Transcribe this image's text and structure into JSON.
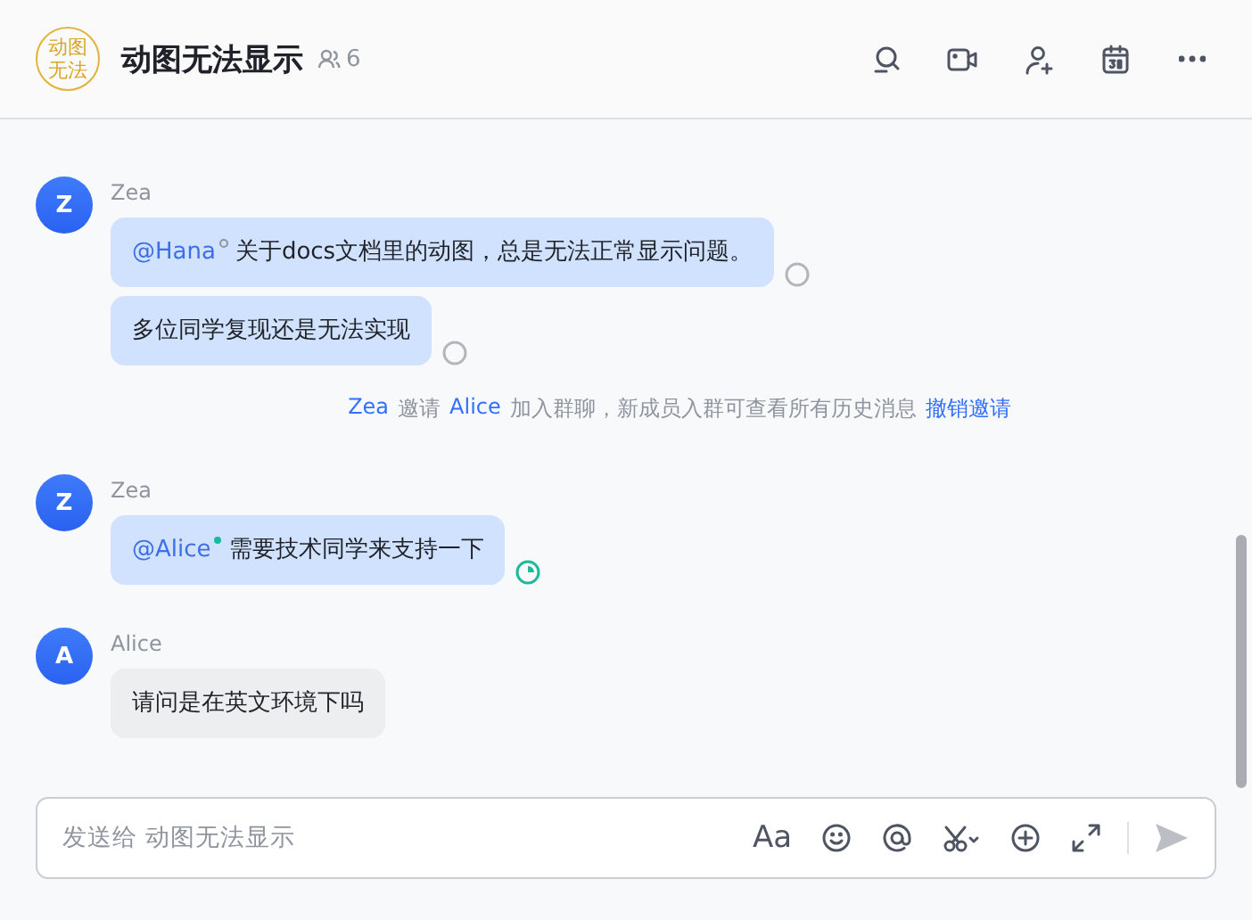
{
  "header": {
    "avatar_text": "动图无法",
    "title": "动图无法显示",
    "member_count": "6"
  },
  "messages": [
    {
      "kind": "group",
      "sender": "Zea",
      "avatar": "Z",
      "mine": true,
      "bubbles": [
        {
          "mention": {
            "text": "@Hana",
            "read": false
          },
          "text": "关于docs文档里的动图，总是无法正常显示问题。",
          "read": false
        },
        {
          "text": "多位同学复现还是无法实现",
          "read": false
        }
      ]
    },
    {
      "kind": "notice",
      "parts": [
        {
          "text": "Zea",
          "link": true
        },
        {
          "text": "邀请",
          "link": false
        },
        {
          "text": "Alice",
          "link": true
        },
        {
          "text": "加入群聊，新成员入群可查看所有历史消息",
          "link": false
        },
        {
          "text": "撤销邀请",
          "link": true
        }
      ]
    },
    {
      "kind": "group",
      "sender": "Zea",
      "avatar": "Z",
      "mine": true,
      "bubbles": [
        {
          "mention": {
            "text": "@Alice",
            "read": true
          },
          "text": "需要技术同学来支持一下",
          "read": true
        }
      ]
    },
    {
      "kind": "group",
      "sender": "Alice",
      "avatar": "A",
      "mine": false,
      "bubbles": [
        {
          "text": "请问是在英文环境下吗"
        }
      ]
    }
  ],
  "composer": {
    "placeholder": "发送给 动图无法显示",
    "format_label": "Aa",
    "send_disabled": true
  }
}
